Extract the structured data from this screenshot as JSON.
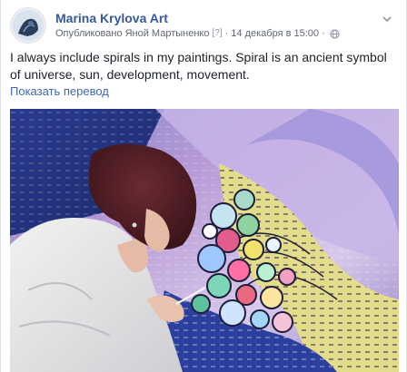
{
  "post": {
    "page_name": "Marina Krylova Art",
    "published_by_prefix": "Опубликовано",
    "author": "Яной Мартыненко",
    "author_badge": "[?]",
    "separator": "·",
    "timestamp": "14 декабря в 15:00",
    "privacy_icon": "globe-icon",
    "text": "I always include spirals in my paintings. Spiral is an ancient symbol of universe, sun, development, movement.",
    "translate_label": "Показать перевод"
  },
  "colors": {
    "link_blue": "#365899",
    "translate_blue": "#4267b2",
    "text": "#1d2129",
    "meta_gray": "#616770"
  }
}
